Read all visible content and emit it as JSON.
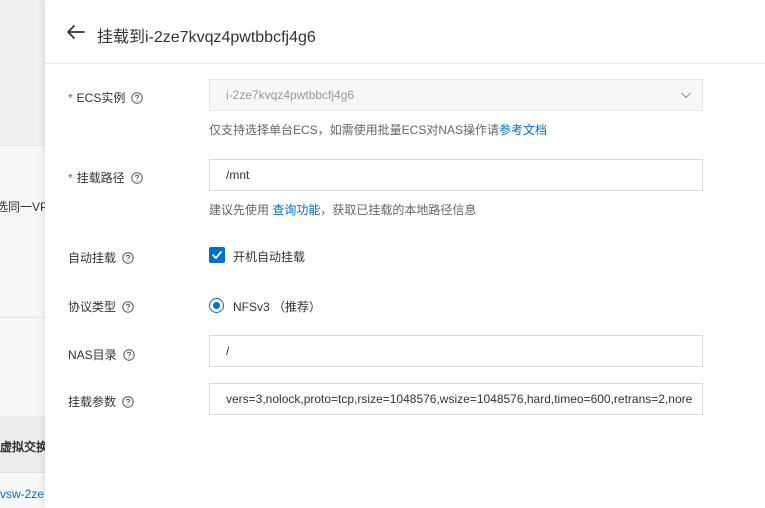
{
  "background": {
    "vpc_text": "选同一VPC",
    "switch_header": "虚拟交换机",
    "vsw_text": "vsw-2ze"
  },
  "drawer": {
    "title": "挂载到i-2ze7kvqz4pwtbbcfj4g6"
  },
  "form": {
    "ecs": {
      "label": "ECS实例",
      "value": "i-2ze7kvqz4pwtbbcfj4g6",
      "hint": "仅支持选择单台ECS，如需使用批量ECS对NAS操作请",
      "hint_link": "参考文档"
    },
    "mount_path": {
      "label": "挂载路径",
      "value": "/mnt",
      "hint_prefix": "建议先使用 ",
      "hint_link": "查询功能",
      "hint_suffix": "，获取已挂载的本地路径信息"
    },
    "auto_mount": {
      "label": "自动挂载",
      "checkbox_label": "开机自动挂载",
      "checked": true
    },
    "protocol": {
      "label": "协议类型",
      "option_label": "NFSv3 （推荐）"
    },
    "nas_dir": {
      "label": "NAS目录",
      "value": "/"
    },
    "mount_params": {
      "label": "挂载参数",
      "value": "vers=3,nolock,proto=tcp,rsize=1048576,wsize=1048576,hard,timeo=600,retrans=2,nore"
    }
  },
  "colors": {
    "primary": "#0070cc",
    "required": "#d93026"
  }
}
